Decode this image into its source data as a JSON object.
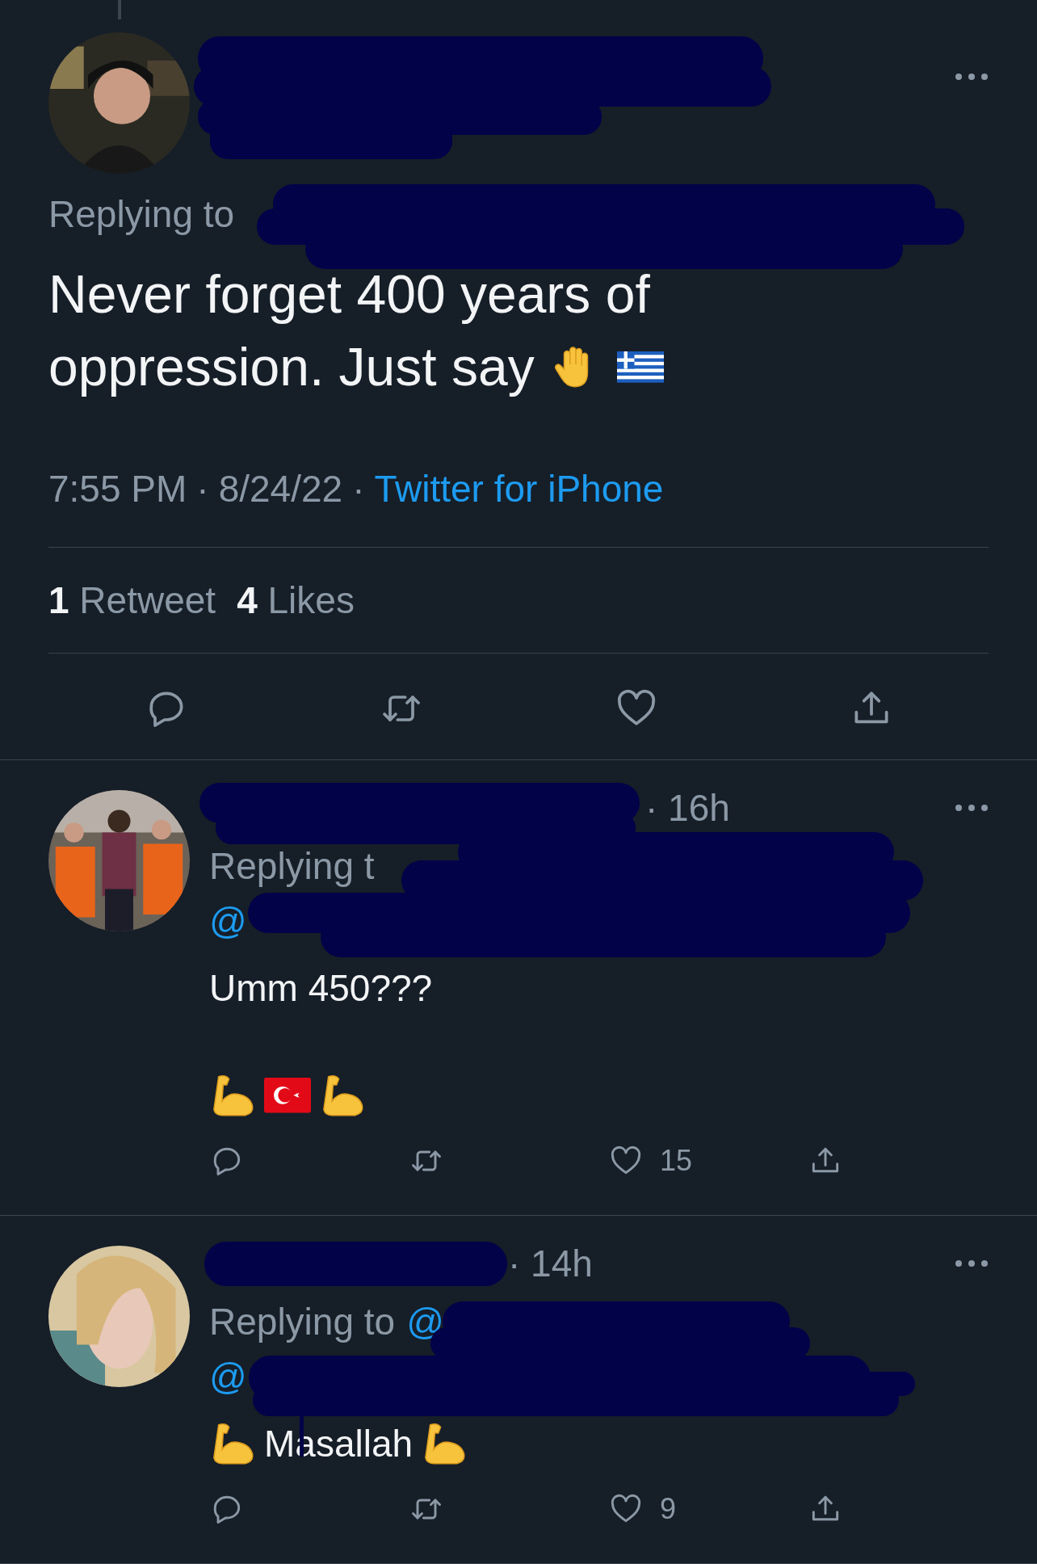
{
  "tweet": {
    "replying_label": "Replying to",
    "text_lines": [
      "Never forget 400 years of",
      "oppression. Just say"
    ],
    "emoji": [
      {
        "kind": "raised-hand"
      },
      {
        "kind": "flag-greece"
      }
    ],
    "time": "7:55 PM",
    "date": "8/24/22",
    "separator": "·",
    "source": "Twitter for iPhone",
    "stats": [
      {
        "count": "1",
        "label": "Retweet"
      },
      {
        "count": "4",
        "label": "Likes"
      }
    ]
  },
  "replies": [
    {
      "time": "· 16h",
      "replying_label": "Replying t",
      "second_handle": "@",
      "body": [
        [
          {
            "kind": "text",
            "text": "Umm 450???"
          }
        ],
        [
          {
            "kind": "flexed-arm"
          },
          {
            "kind": "flag-turkey"
          },
          {
            "kind": "flexed-arm"
          }
        ]
      ],
      "likes": "15"
    },
    {
      "time": "· 14h",
      "replying_label": "Replying to",
      "replying_handle": "@",
      "second_handle": "@",
      "body": [
        [
          {
            "kind": "flexed-arm"
          },
          {
            "kind": "text",
            "text": "Masallah"
          },
          {
            "kind": "flexed-arm"
          }
        ]
      ],
      "likes": "9"
    }
  ]
}
